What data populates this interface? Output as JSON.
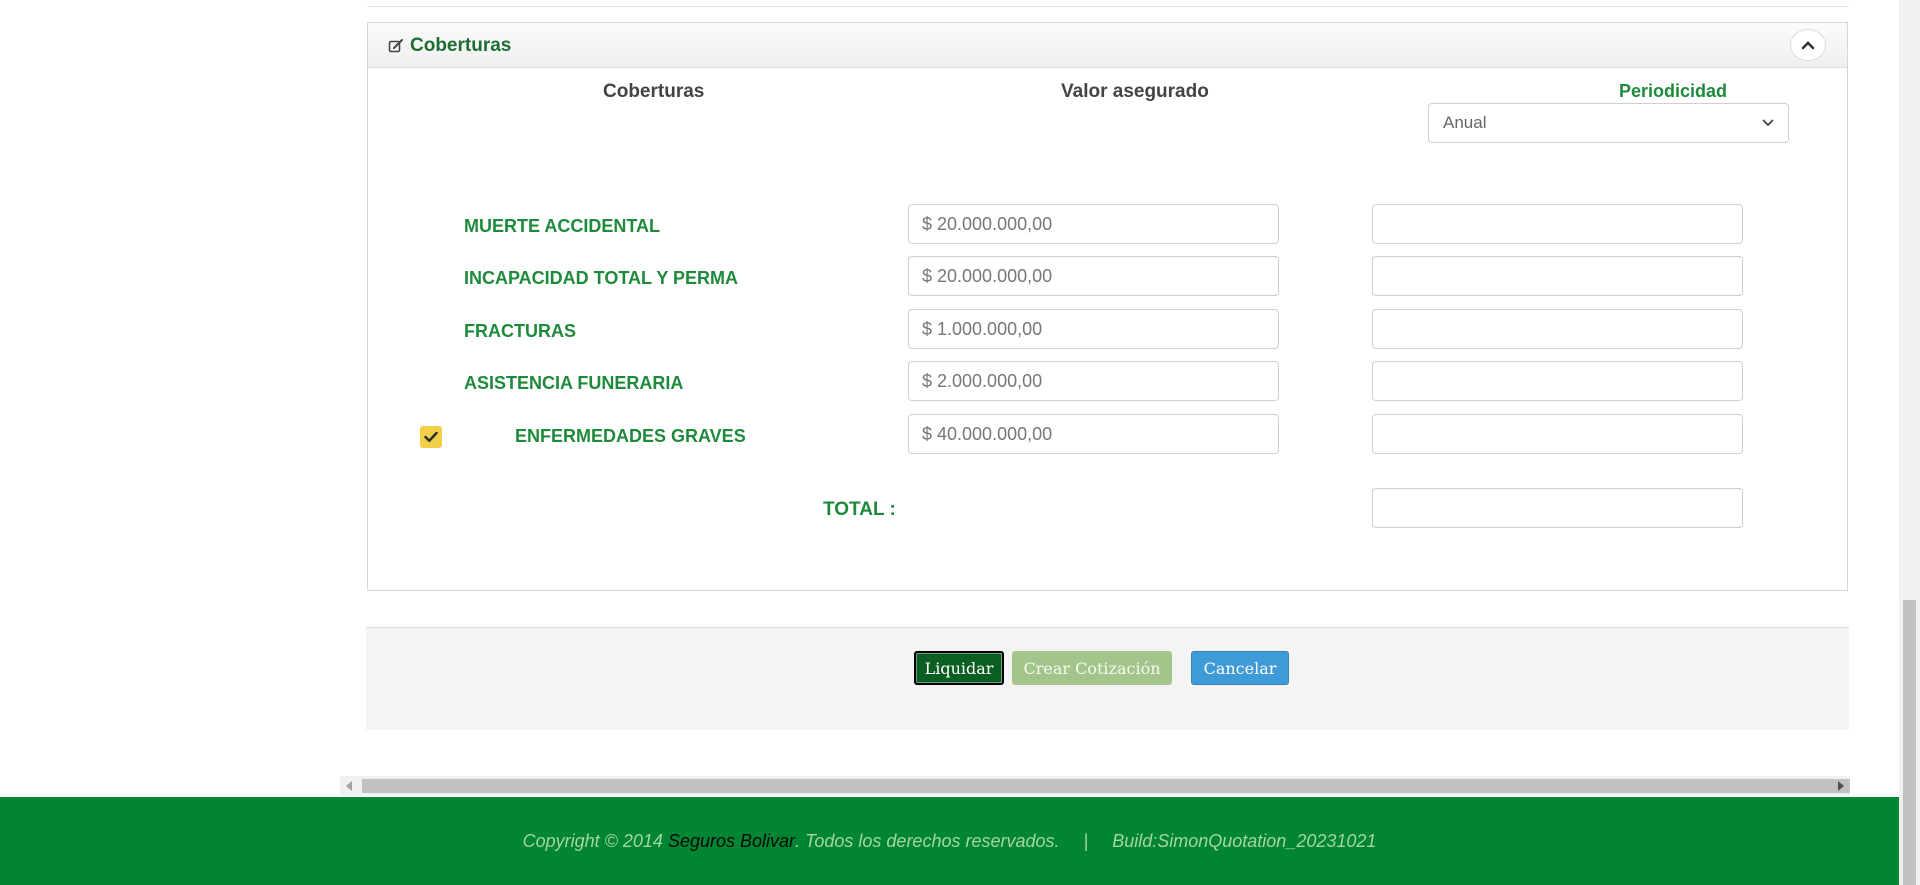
{
  "panel": {
    "title": "Coberturas",
    "headers": {
      "coverage": "Coberturas",
      "insured_value": "Valor asegurado",
      "periodicity": "Periodicidad"
    },
    "periodicity_select": {
      "selected": "Anual"
    },
    "rows": [
      {
        "label": "MUERTE ACCIDENTAL",
        "value": "$ 20.000.000,00",
        "premium": ""
      },
      {
        "label": "INCAPACIDAD TOTAL Y PERMA",
        "value": "$ 20.000.000,00",
        "premium": ""
      },
      {
        "label": "FRACTURAS",
        "value": "$ 1.000.000,00",
        "premium": ""
      },
      {
        "label": "ASISTENCIA FUNERARIA",
        "value": "$ 2.000.000,00",
        "premium": ""
      },
      {
        "label": "ENFERMEDADES GRAVES",
        "value": "$ 40.000.000,00",
        "premium": "",
        "checked": true
      }
    ],
    "total_label": "TOTAL :",
    "total_value": ""
  },
  "actions": {
    "liquidar": "Liquidar",
    "crear": "Crear Cotización",
    "cancelar": "Cancelar"
  },
  "footer": {
    "copyright_prefix": "Copyright © 2014 ",
    "brand": "Seguros Bolivar",
    "rights": ". Todos los derechos reservados.",
    "separator": "|",
    "build": "Build:SimonQuotation_20231021"
  },
  "colors": {
    "brand_green": "#008533",
    "label_green": "#1e8a3c",
    "checkbox_yellow": "#f1cf47",
    "cancel_blue": "#3f9ad8"
  }
}
